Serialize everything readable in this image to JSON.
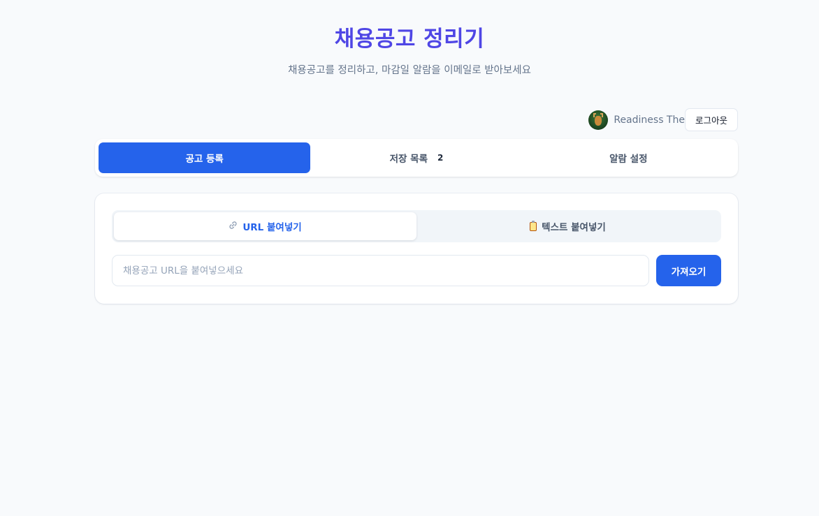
{
  "header": {
    "title": "채용공고 정리기",
    "subtitle": "채용공고를 정리하고, 마감일 알람을 이메일로 받아보세요"
  },
  "user": {
    "avatar_icon": "deer-avatar",
    "name": "Readiness The",
    "logout_label": "로그아웃"
  },
  "tabs": [
    {
      "label": "공고 등록",
      "active": true
    },
    {
      "label": "저장 목록",
      "badge": "2",
      "active": false
    },
    {
      "label": "알람 설정",
      "active": false
    }
  ],
  "input_mode": {
    "options": [
      {
        "icon": "link-icon",
        "label": "URL 붙여넣기",
        "active": true
      },
      {
        "icon": "clipboard-icon",
        "label": "텍스트 붙여넣기",
        "active": false
      }
    ]
  },
  "url_form": {
    "placeholder": "채용공고 URL을 붙여넣으세요",
    "value": "",
    "submit_label": "가져오기"
  },
  "colors": {
    "accent": "#2563eb",
    "title": "#4f46e5",
    "background": "#f8fafc"
  }
}
